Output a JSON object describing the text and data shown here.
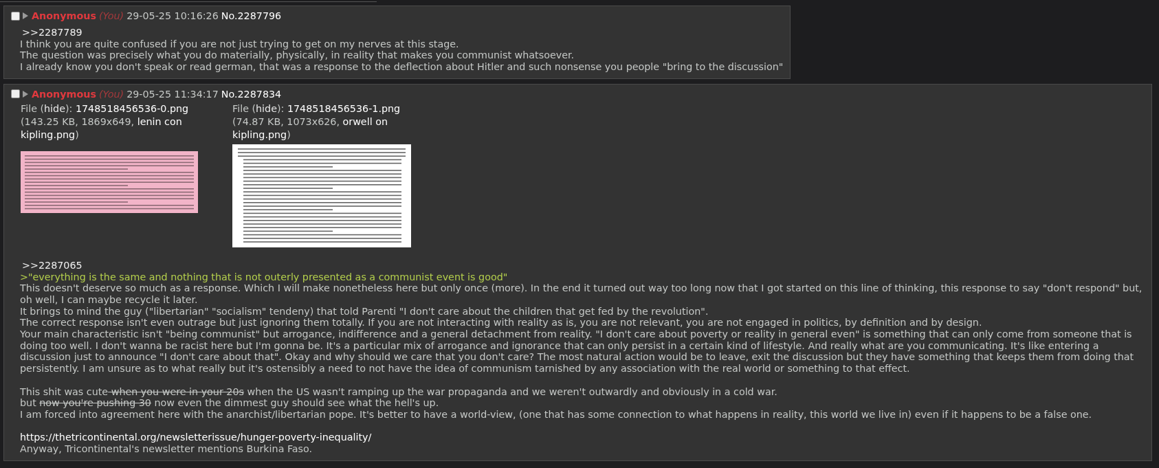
{
  "posts": [
    {
      "checked": false,
      "name": "Anonymous",
      "you": "(You)",
      "date": "29-05-25 10:16:26",
      "number": "No.2287796",
      "body": [
        {
          "kind": "quotelink",
          "text": ">>2287789"
        },
        {
          "kind": "text",
          "text": "I think you are quite confused if you are not just trying to get on my nerves at this stage."
        },
        {
          "kind": "text",
          "text": "The question was precisely what you do materially, physically, in reality that makes you communist whatsoever."
        },
        {
          "kind": "text",
          "text": "I already know you don't speak or read german, that was a response to the deflection about Hitler and such nonsense you people \"bring to the discussion\""
        }
      ]
    },
    {
      "checked": false,
      "name": "Anonymous",
      "you": "(You)",
      "date": "29-05-25 11:34:17",
      "number": "No.2287834",
      "files": [
        {
          "parts": [
            {
              "text": "File ("
            },
            {
              "kind": "hide",
              "text": "hide"
            },
            {
              "text": "): "
            },
            {
              "kind": "filename",
              "text": "1748518456536-0.png"
            },
            {
              "text": " (143.25 KB, 1869x649, "
            },
            {
              "kind": "original",
              "text": "lenin con kipling.png"
            },
            {
              "text": ")"
            }
          ],
          "thumbnail": {
            "color": "#f2b4c8"
          }
        },
        {
          "parts": [
            {
              "text": "File ("
            },
            {
              "kind": "hide",
              "text": "hide"
            },
            {
              "text": "): "
            },
            {
              "kind": "filename",
              "text": "1748518456536-1.png"
            },
            {
              "text": " (74.87 KB, 1073x626, "
            },
            {
              "kind": "original",
              "text": "orwell on kipling.png"
            },
            {
              "text": ")"
            }
          ],
          "thumbnail": {
            "color": "#ffffff"
          }
        }
      ],
      "body": [
        {
          "kind": "quotelink",
          "text": ">>2287065"
        },
        {
          "kind": "greentext",
          "text": ">\"everything is the same and nothing that is not outerly presented as a communist event is good\""
        },
        {
          "kind": "text",
          "text": "This doesn't deserve so much as a response. Which I will make nonetheless here but only once (more). In the end it turned out way too long now that I got started on this line of thinking, this response to say \"don't respond\" but, oh well, I can maybe recycle it later."
        },
        {
          "kind": "text",
          "text": "It brings to mind the guy (\"libertarian\" \"socialism\" tendeny) that told Parenti \"I don't care about the children that get fed by the revolution\"."
        },
        {
          "kind": "text",
          "text": "The correct response isn't even outrage but just ignoring them totally. If you are not interacting with reality as is, you are not relevant, you are not engaged in politics, by definition and by design."
        },
        {
          "kind": "text",
          "text": "Your main characteristic isn't \"being communist\" but arrogance, indifference and a general detachment from reality. \"I don't care about poverty or reality in general even\" is something that can only come from someone that is doing too well. I don't wanna be racist here but I'm gonna be. It's a particular mix of arrogance and ignorance that can only persist in a certain kind of lifestyle. And really what are you communicating. It's like entering a discussion just to announce \"I don't care about that\". Okay and why should we care that you don't care? The most natural action would be to leave, exit the discussion but they have something that keeps them from doing that persistently. I am unsure as to what really but it's ostensibly a need to not have the idea of communism tarnished by any association with the real world or something to that effect."
        },
        {
          "kind": "gap"
        },
        {
          "kind": "text",
          "parts": [
            {
              "text": "This shit was cute"
            },
            {
              "text": " when you were in your 20s",
              "strike": true
            },
            {
              "text": " when the US wasn't ramping up the war propaganda and we weren't outwardly and obviously in a cold war."
            }
          ]
        },
        {
          "kind": "text",
          "parts": [
            {
              "text": "but "
            },
            {
              "text": "now you're pushing 30",
              "strike": true
            },
            {
              "text": " now even the dimmest guy should see what the hell's up."
            }
          ]
        },
        {
          "kind": "text",
          "text": "I am forced into agreement here with the anarchist/libertarian pope. It's better to have a world-view, (one that has some connection to what happens in reality, this world we live in) even if it happens to be a false one."
        },
        {
          "kind": "gap"
        },
        {
          "kind": "url",
          "text": "https://thetricontinental.org/newsletterissue/hunger-poverty-inequality/"
        },
        {
          "kind": "text",
          "text": "Anyway, Tricontinental's newsletter mentions Burkina Faso."
        }
      ]
    }
  ]
}
